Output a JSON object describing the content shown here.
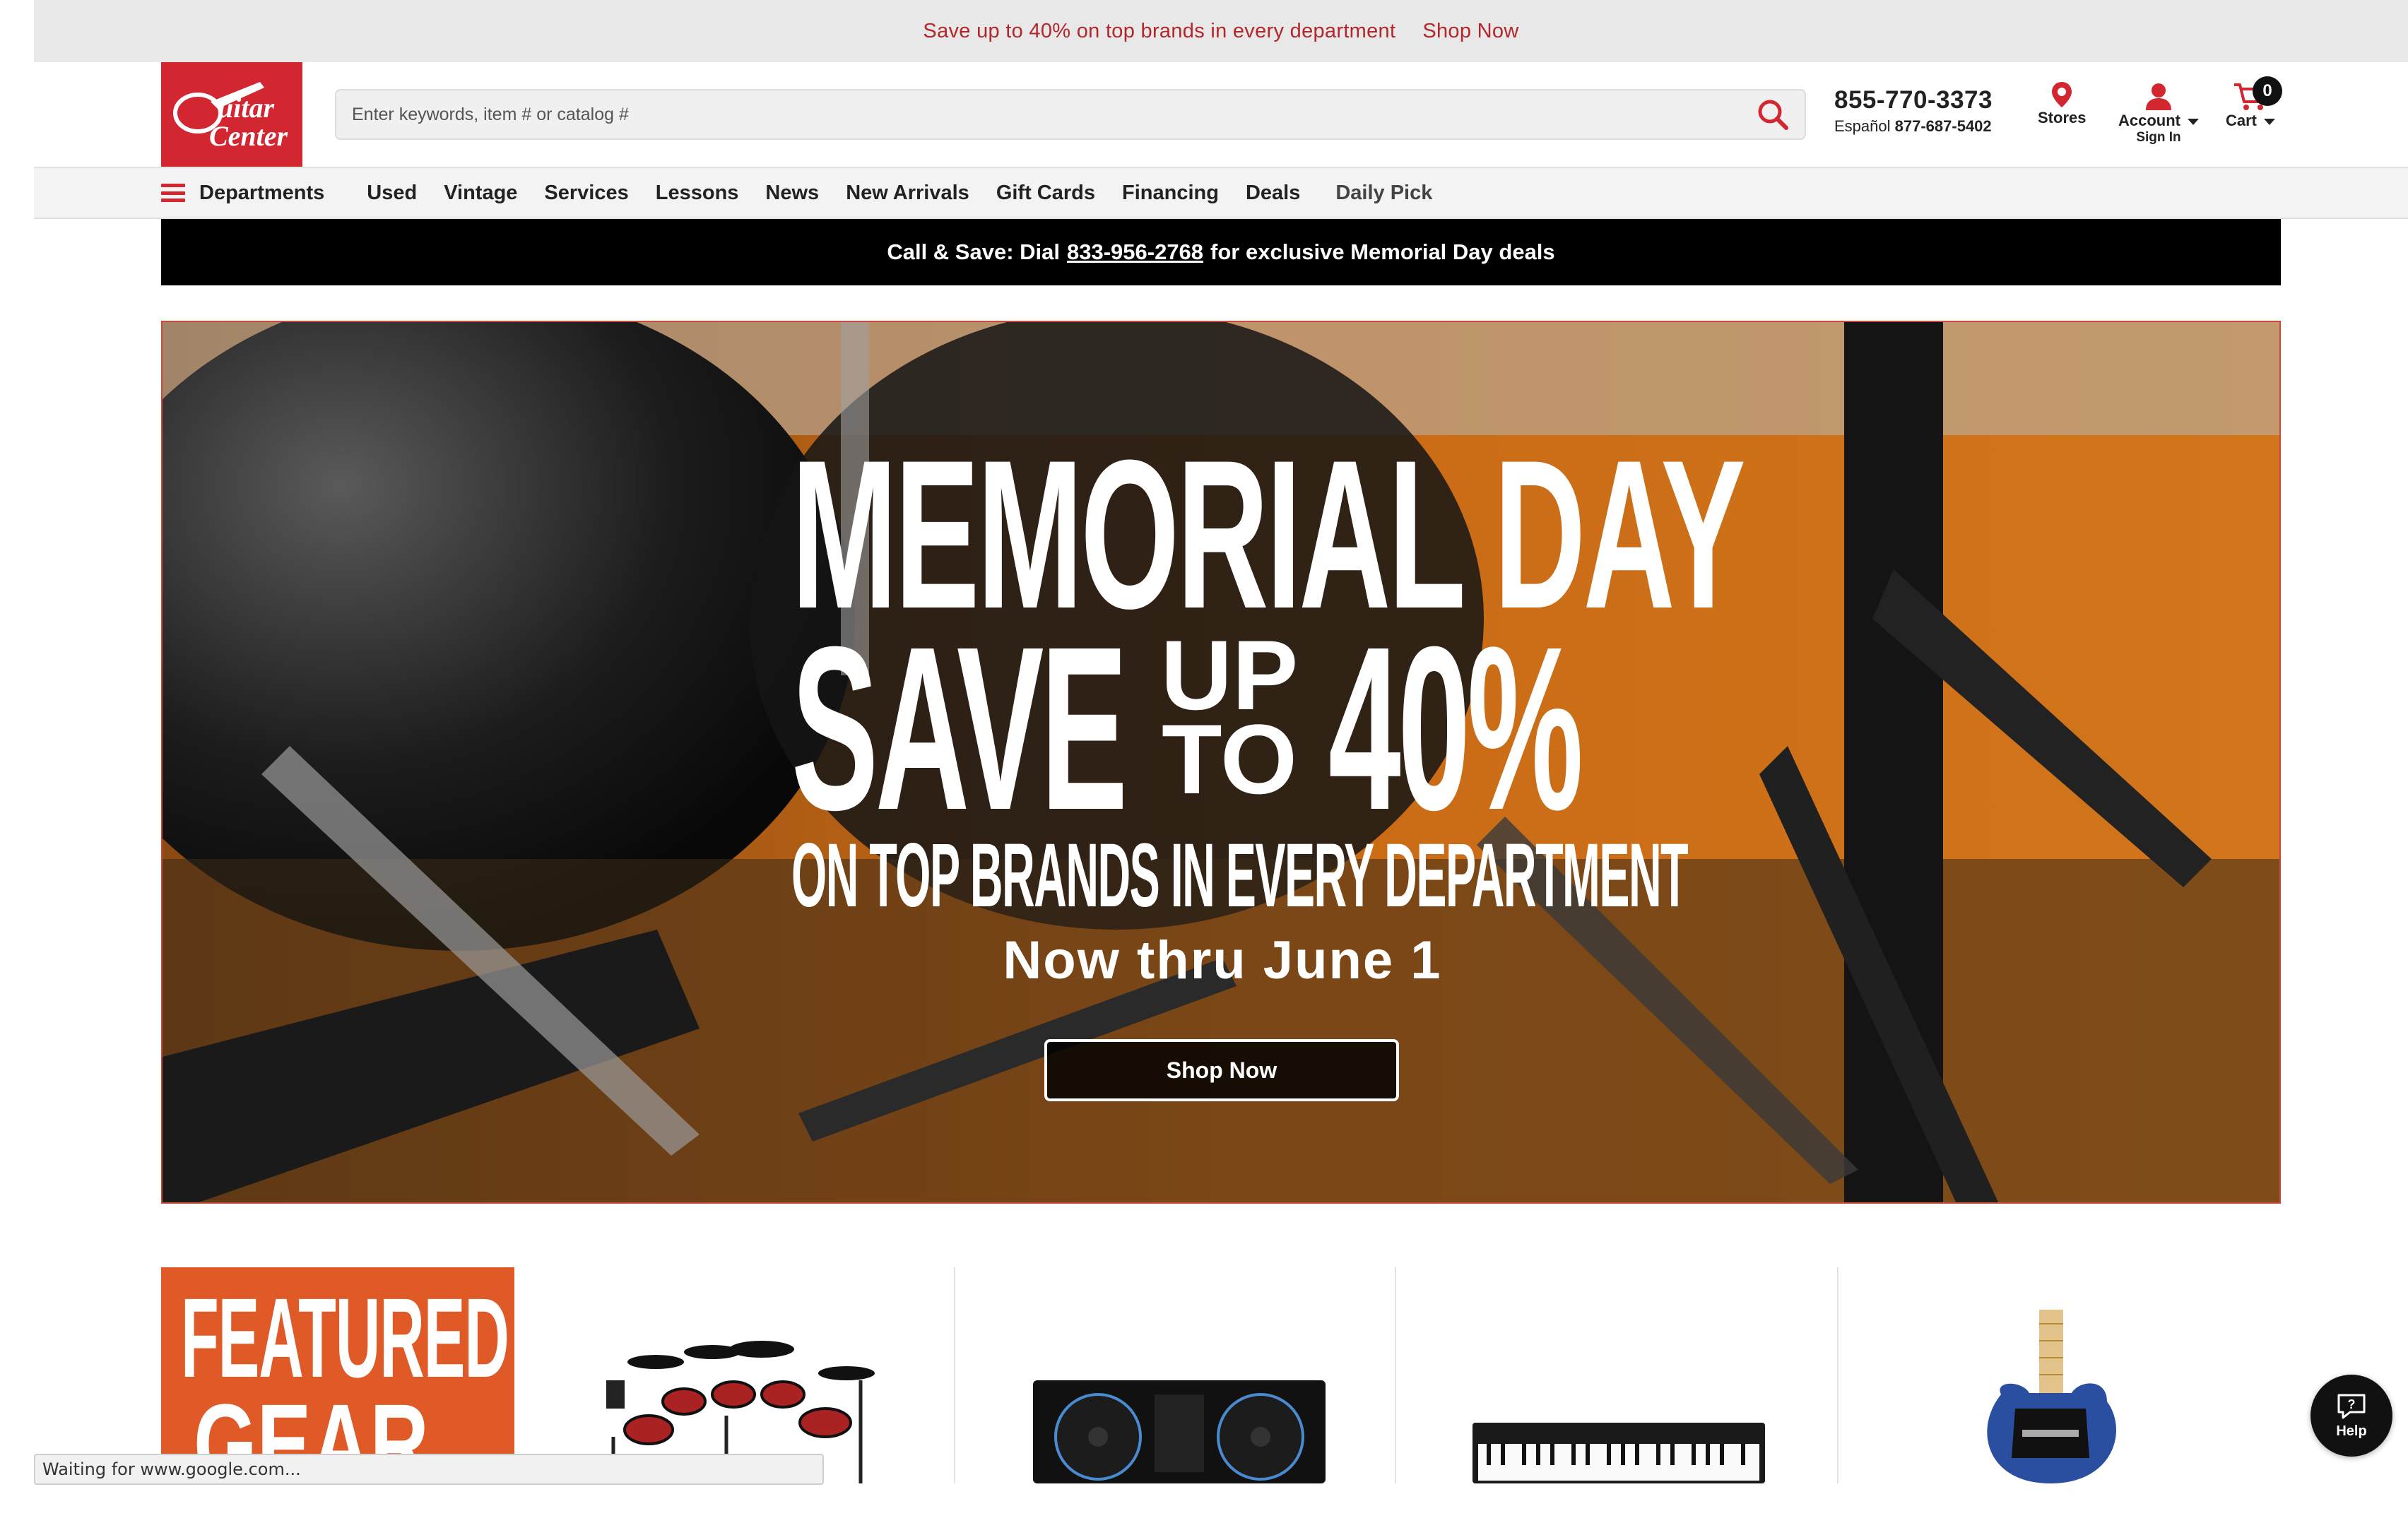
{
  "promo": {
    "text": "Save up to 40% on top brands in every department",
    "link": "Shop Now"
  },
  "header": {
    "logo_alt": "Guitar Center",
    "search_placeholder": "Enter keywords, item # or catalog #",
    "phone": "855-770-3373",
    "espanol_label": "Español",
    "espanol_phone": "877-687-5402",
    "stores_label": "Stores",
    "account_label": "Account",
    "account_sub": "Sign In",
    "cart_label": "Cart",
    "cart_count": "0"
  },
  "nav": {
    "departments": "Departments",
    "items": [
      "Used",
      "Vintage",
      "Services",
      "Lessons",
      "News",
      "New Arrivals",
      "Gift Cards",
      "Financing",
      "Deals",
      "Daily Pick"
    ]
  },
  "call_bar": {
    "prefix": "Call & Save: Dial",
    "phone": "833-956-2768",
    "suffix": "for exclusive Memorial Day deals"
  },
  "hero": {
    "line1": "MEMORIAL DAY",
    "save": "SAVE",
    "up": "UP",
    "to": "TO",
    "percent": "40%",
    "brands": "ON TOP BRANDS IN EVERY DEPARTMENT",
    "dates": "Now thru June 1",
    "button": "Shop Now"
  },
  "featured": {
    "line1": "FEATURED",
    "line2": "GEAR"
  },
  "status_bar": "Waiting for www.google.com...",
  "help_label": "Help",
  "colors": {
    "brand_red": "#d22630",
    "promo_red": "#b3262b",
    "orange": "#e05a28"
  }
}
